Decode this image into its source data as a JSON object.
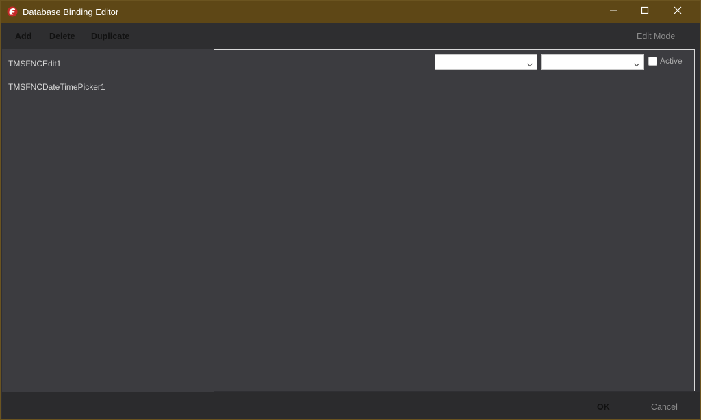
{
  "window": {
    "title": "Database Binding Editor",
    "colors": {
      "titlebar": "#5e4716",
      "panel": "#3c3c40",
      "toolbar": "#2e2e30"
    }
  },
  "toolbar": {
    "add_label": "Add",
    "delete_label": "Delete",
    "duplicate_label": "Duplicate",
    "edit_mode_label_underlined": "E",
    "edit_mode_label_rest": "dit Mode"
  },
  "bindings_list": {
    "items": [
      {
        "label": "TMSFNCEdit1"
      },
      {
        "label": "TMSFNCDateTimePicker1"
      }
    ]
  },
  "editor": {
    "combo1_value": "",
    "combo2_value": "",
    "active_label": "Active",
    "active_checked": false
  },
  "footer": {
    "ok_label": "OK",
    "cancel_label": "Cancel"
  },
  "icons": {
    "app": "delphi-helmet-icon",
    "minimize": "minimize-icon",
    "maximize": "maximize-icon",
    "close": "close-icon",
    "dropdown": "chevron-down-icon"
  }
}
